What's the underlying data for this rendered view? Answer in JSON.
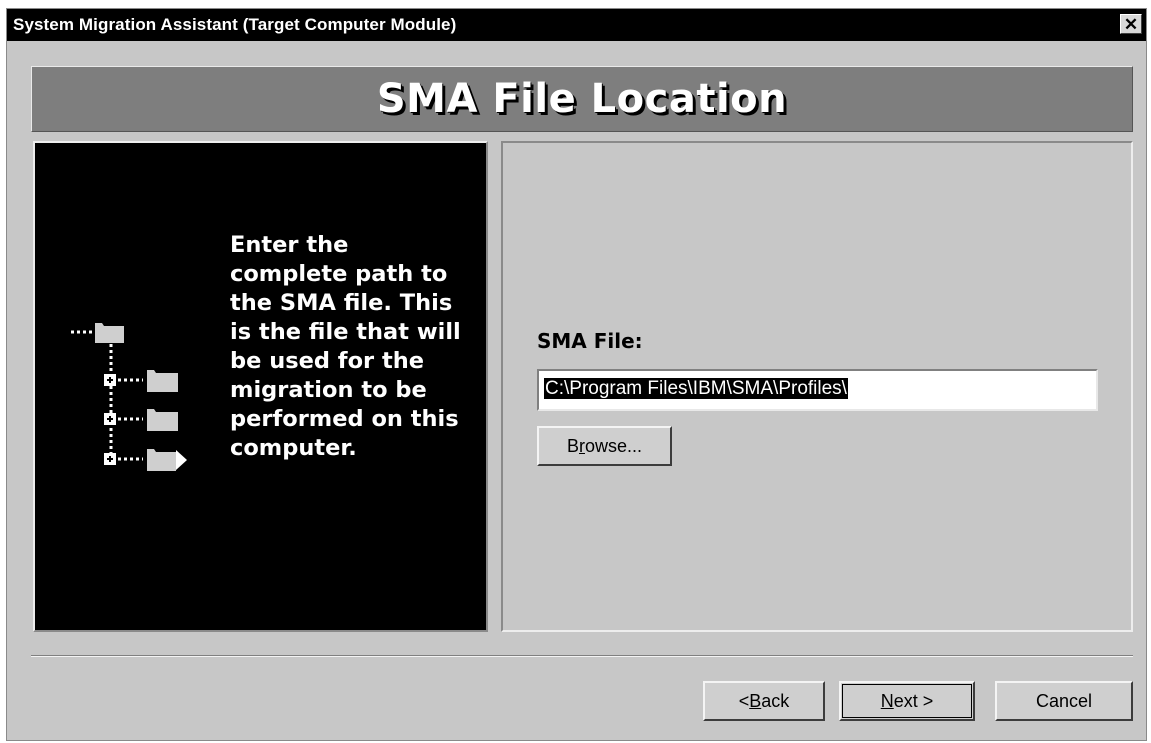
{
  "window": {
    "title": "System Migration Assistant (Target Computer Module)",
    "close_label": "✕"
  },
  "banner": {
    "title": "SMA File Location"
  },
  "left_panel": {
    "instructions": "Enter the complete path to the SMA file.  This is the file that will be used for the migration to be performed on this computer."
  },
  "form": {
    "label": "SMA File:",
    "path_value": "C:\\Program Files\\IBM\\SMA\\Profiles\\",
    "browse": {
      "before": "B",
      "accel": "r",
      "after": "owse..."
    }
  },
  "footer": {
    "back": {
      "prefix": "< ",
      "accel": "B",
      "rest": "ack"
    },
    "next": {
      "accel": "N",
      "rest": "ext >"
    },
    "cancel": "Cancel"
  }
}
